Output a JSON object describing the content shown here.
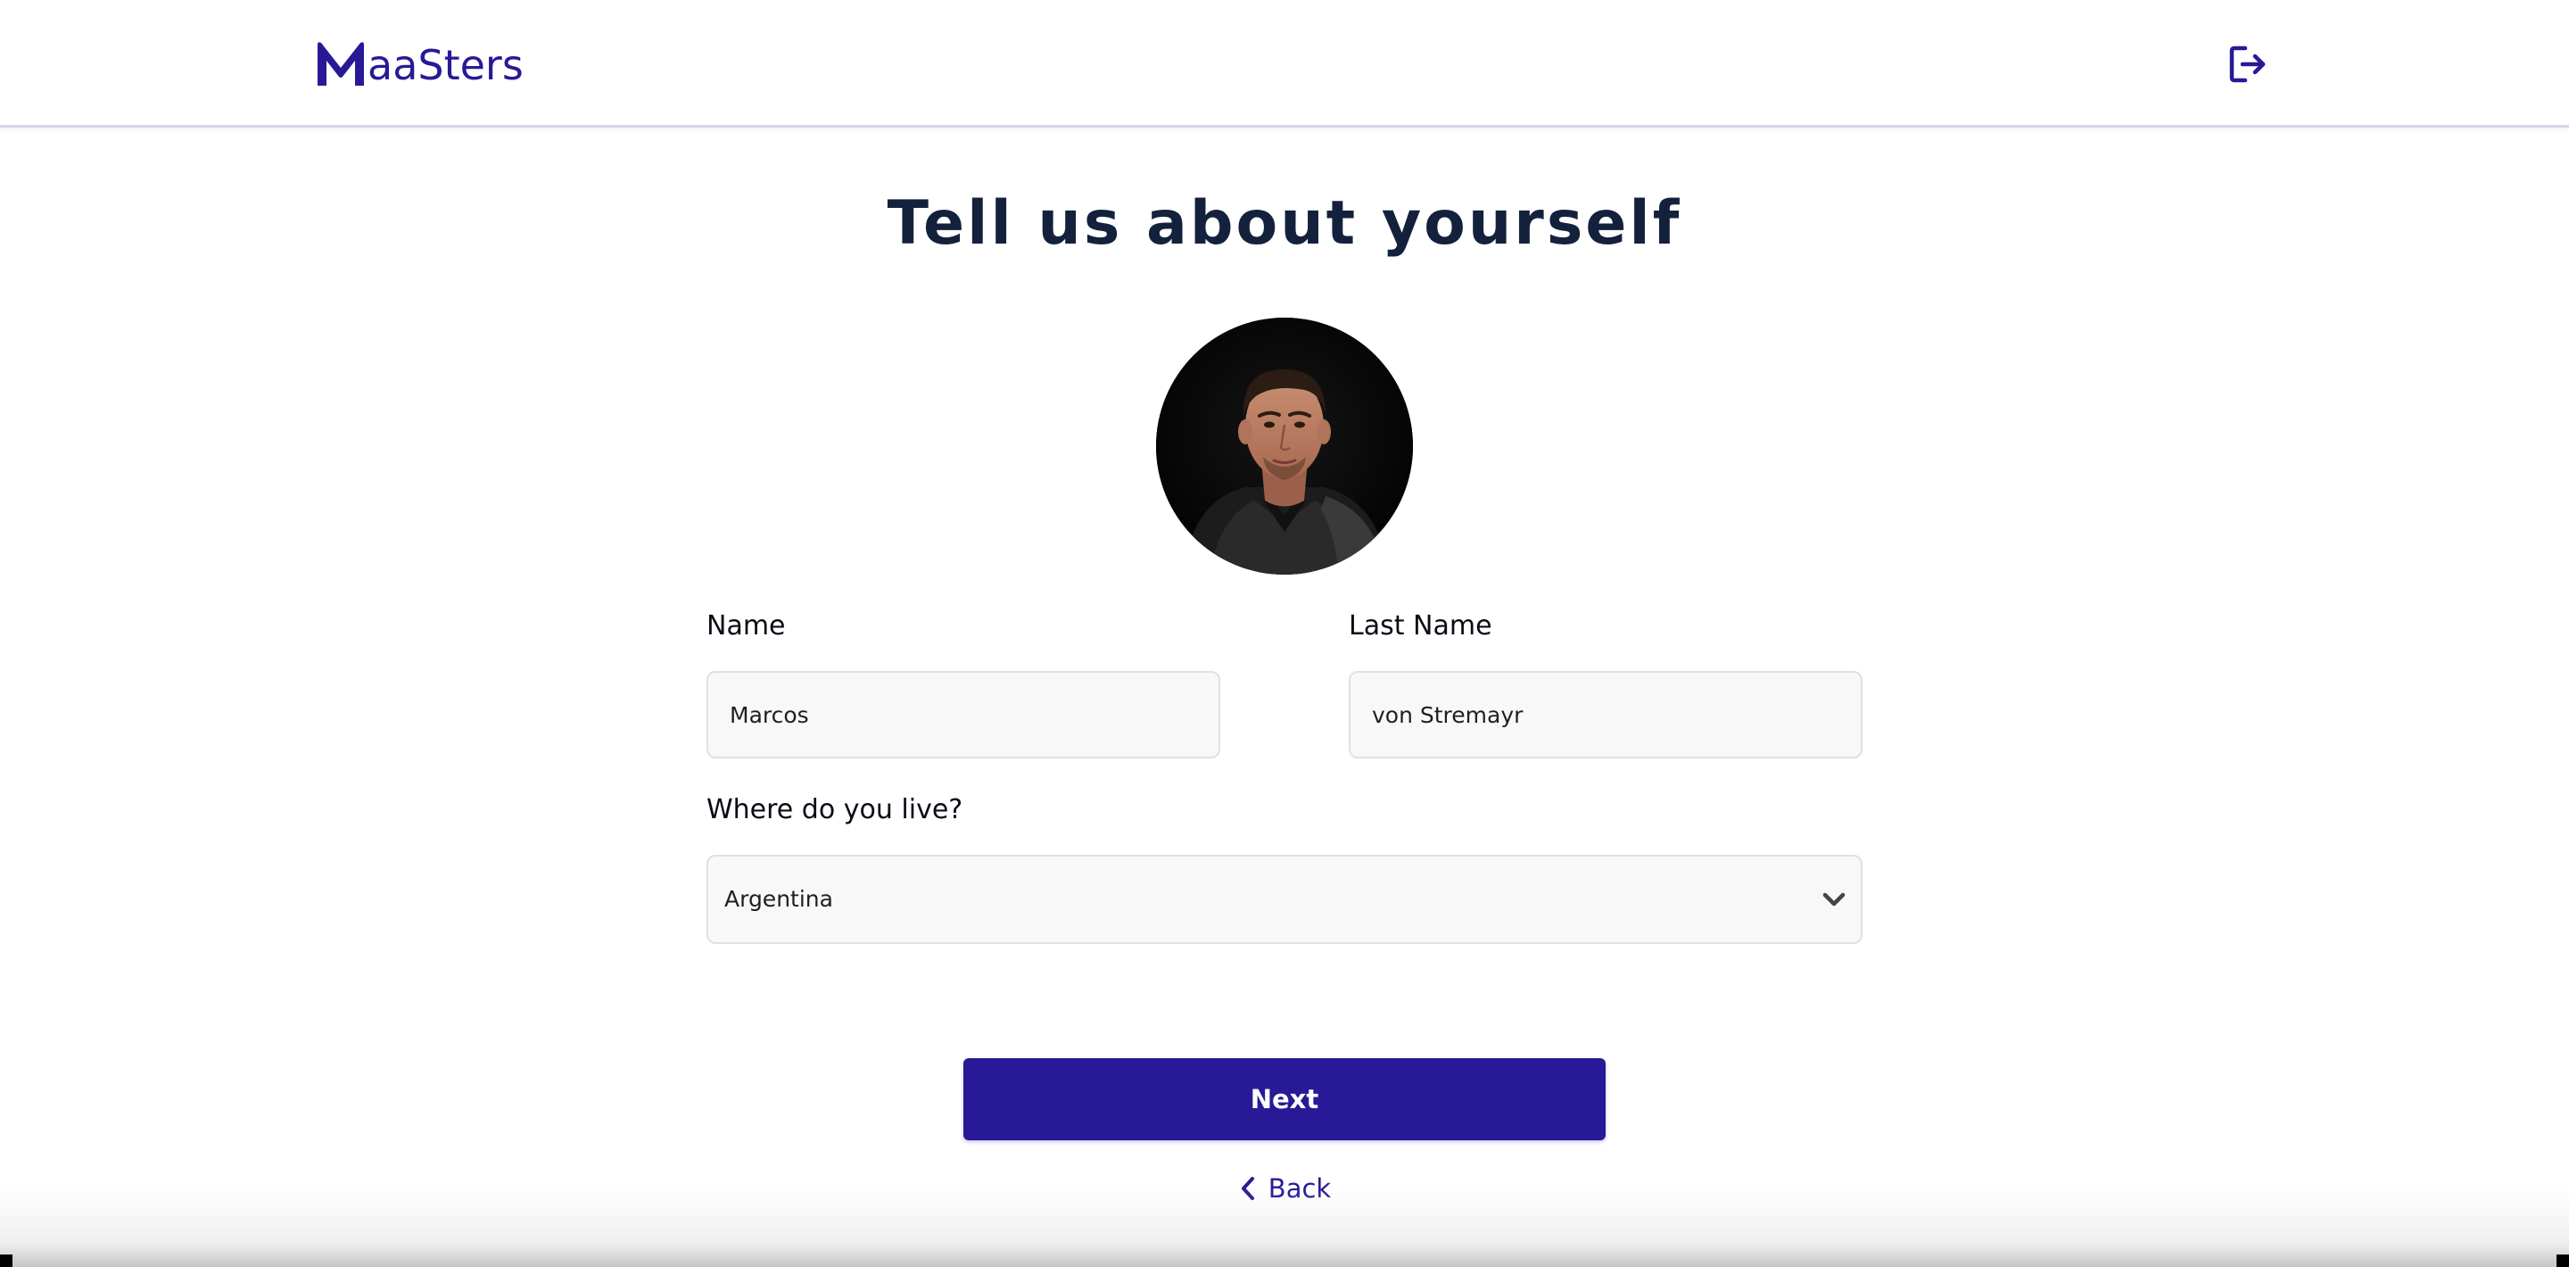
{
  "brand": {
    "logo_text": "aaSters",
    "logo_initial": "M",
    "color": "#281a96"
  },
  "header": {
    "logout_icon": "logout-icon"
  },
  "main": {
    "title": "Tell us about yourself",
    "avatar_alt": "profile-photo"
  },
  "form": {
    "name_label": "Name",
    "name_value": "Marcos",
    "last_name_label": "Last Name",
    "last_name_value": "von Stremayr",
    "residence_label": "Where do you live?",
    "residence_value": "Argentina"
  },
  "actions": {
    "next_label": "Next",
    "back_label": "Back"
  },
  "colors": {
    "primary": "#281a96",
    "title": "#14213d",
    "input_bg": "#f8f8f8",
    "input_border": "#e1e1e1"
  }
}
